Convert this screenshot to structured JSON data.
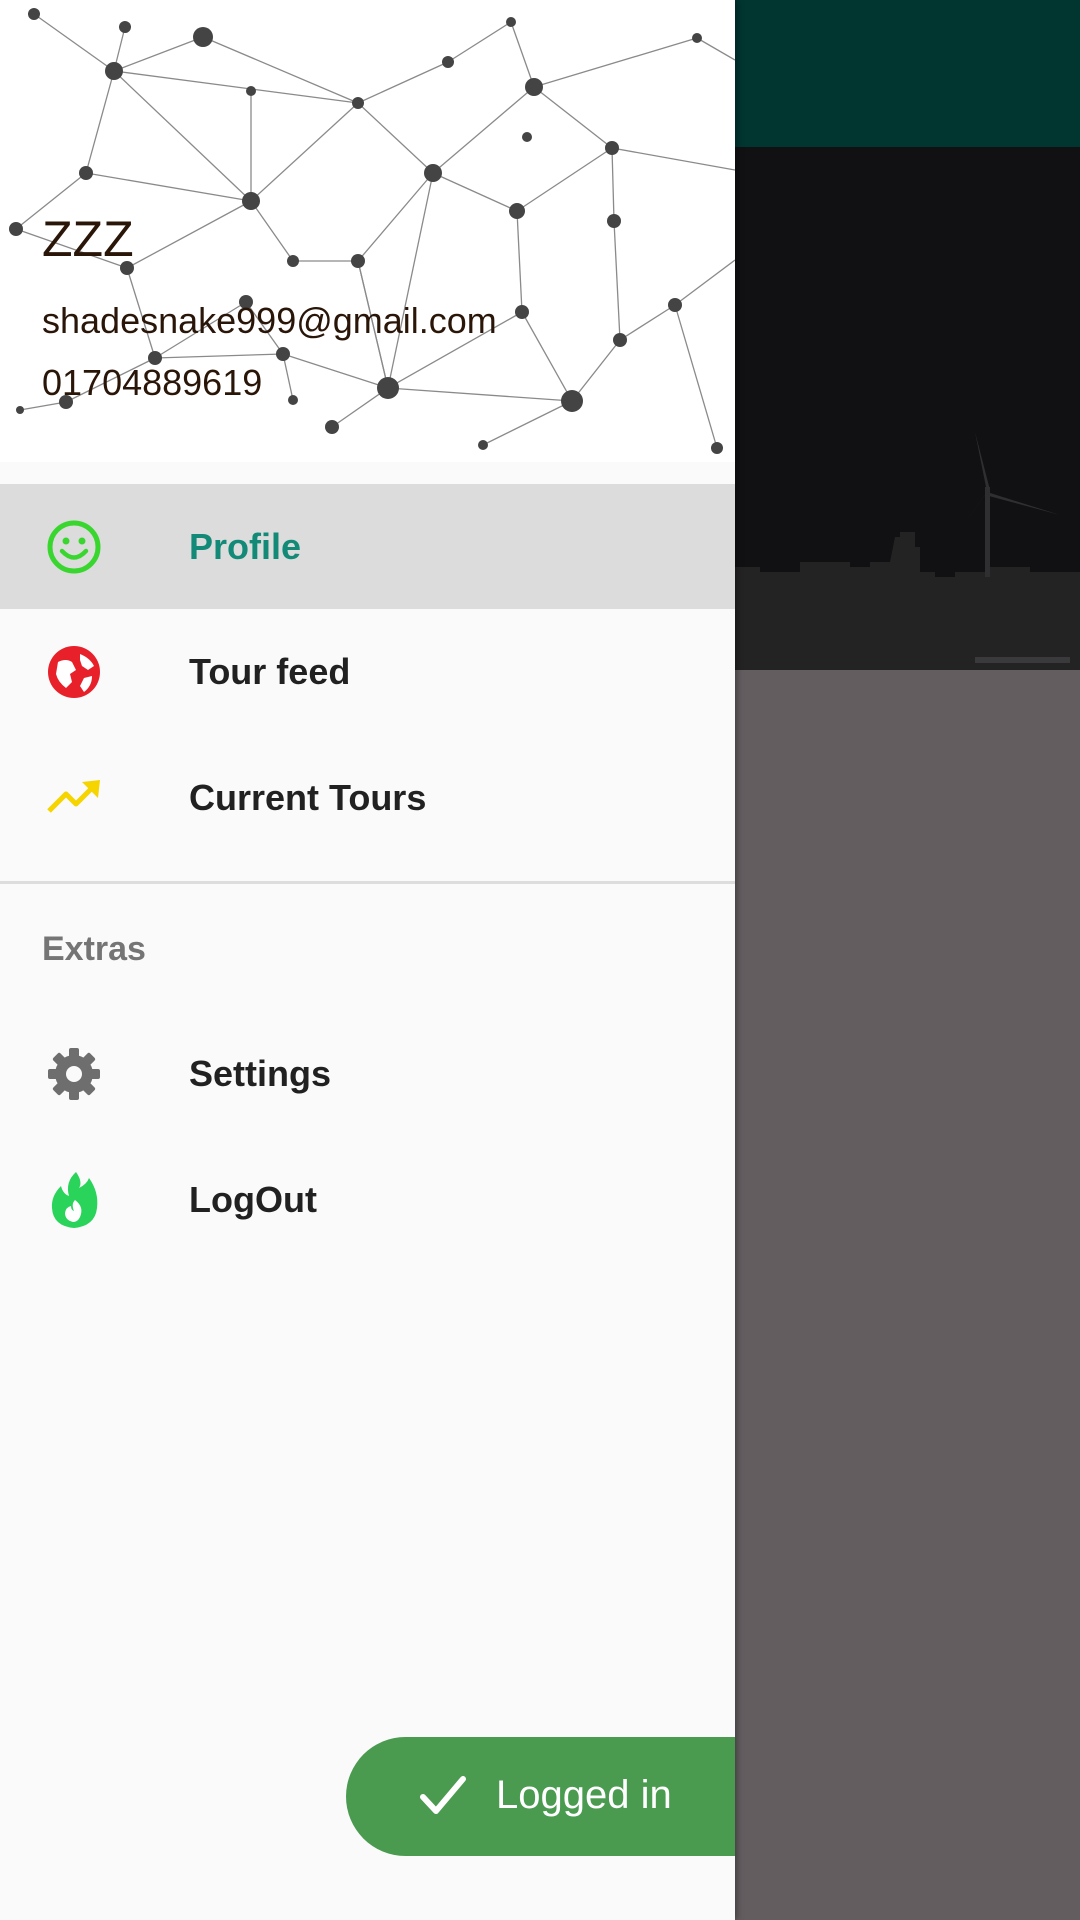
{
  "drawer": {
    "header": {
      "name": "ZZZ",
      "email": "shadesnake999@gmail.com",
      "phone": "01704889619"
    },
    "items": [
      {
        "label": "Profile",
        "icon": "smiley-icon",
        "active": true,
        "icon_color": "#3ad630"
      },
      {
        "label": "Tour feed",
        "icon": "globe-icon",
        "active": false,
        "icon_color": "#e8202a"
      },
      {
        "label": "Current Tours",
        "icon": "trending-up-icon",
        "active": false,
        "icon_color": "#f5d400"
      }
    ],
    "extras": {
      "title": "Extras",
      "items": [
        {
          "label": "Settings",
          "icon": "gear-icon",
          "icon_color": "#6e6e6e"
        },
        {
          "label": "LogOut",
          "icon": "flame-icon",
          "icon_color": "#2ad35a"
        }
      ]
    }
  },
  "toast": {
    "label": "Logged in",
    "icon": "check-icon"
  },
  "colors": {
    "accent": "#138a78",
    "app_bar": "#003530",
    "toast": "#4a9a50"
  }
}
